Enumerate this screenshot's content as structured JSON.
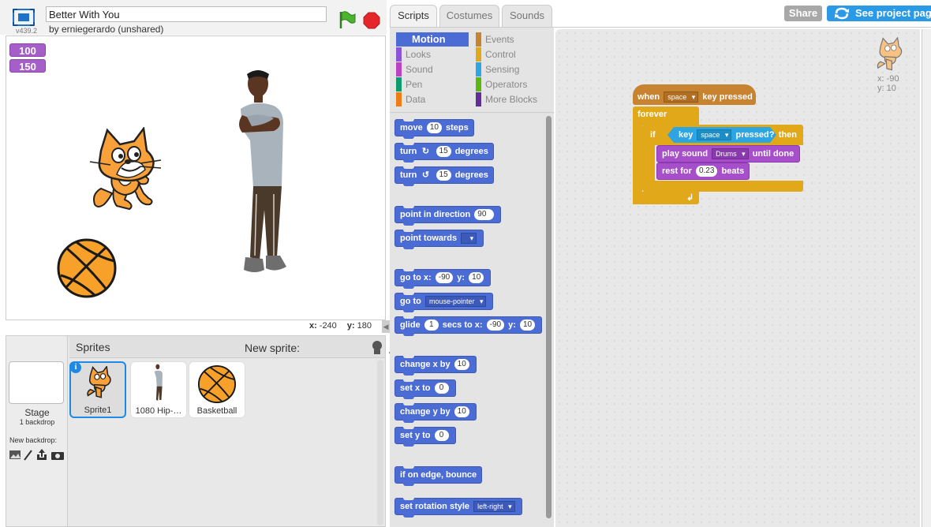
{
  "header": {
    "version": "v439.2",
    "project_title": "Better With You",
    "byline": "by erniegerardo (unshared)"
  },
  "stage": {
    "monitors": [
      "100",
      "150"
    ],
    "coords": {
      "x_label": "x:",
      "x_value": "-240",
      "y_label": "y:",
      "y_value": "180"
    }
  },
  "sprites_panel": {
    "title": "Sprites",
    "new_sprite_label": "New sprite:",
    "stage_label": "Stage",
    "stage_backdrops": "1 backdrop",
    "new_backdrop_label": "New backdrop:",
    "sprites": [
      {
        "name": "Sprite1",
        "selected": true
      },
      {
        "name": "1080 Hip-…",
        "selected": false
      },
      {
        "name": "Basketball",
        "selected": false
      }
    ]
  },
  "tabs": [
    "Scripts",
    "Costumes",
    "Sounds"
  ],
  "top_buttons": {
    "share": "Share",
    "see_project_page": "See project page"
  },
  "categories": {
    "left": [
      "Motion",
      "Looks",
      "Sound",
      "Pen",
      "Data"
    ],
    "right": [
      "Events",
      "Control",
      "Sensing",
      "Operators",
      "More Blocks"
    ],
    "colors": {
      "Motion": "#4a6cd4",
      "Looks": "#8a55d7",
      "Sound": "#bb42c3",
      "Pen": "#0e9a6c",
      "Data": "#ee7d16",
      "Events": "#c88330",
      "Control": "#e1a91a",
      "Sensing": "#2ca5e2",
      "Operators": "#5cb712",
      "More Blocks": "#632d99"
    }
  },
  "palette_blocks": {
    "move": {
      "a": "move",
      "n": "10",
      "b": "steps"
    },
    "turn_cw": {
      "a": "turn",
      "n": "15",
      "b": "degrees"
    },
    "turn_ccw": {
      "a": "turn",
      "n": "15",
      "b": "degrees"
    },
    "point_dir": {
      "a": "point in direction",
      "n": "90"
    },
    "point_towards": {
      "a": "point towards"
    },
    "goto_xy": {
      "a": "go to x:",
      "x": "-90",
      "b": "y:",
      "y": "10"
    },
    "goto": {
      "a": "go to",
      "d": "mouse-pointer"
    },
    "glide": {
      "a": "glide",
      "n": "1",
      "b": "secs to x:",
      "x": "-90",
      "c": "y:",
      "y": "10"
    },
    "change_x": {
      "a": "change x by",
      "n": "10"
    },
    "set_x": {
      "a": "set x to",
      "n": "0"
    },
    "change_y": {
      "a": "change y by",
      "n": "10"
    },
    "set_y": {
      "a": "set y to",
      "n": "0"
    },
    "bounce": {
      "a": "if on edge, bounce"
    },
    "rotation_style": {
      "a": "set rotation style",
      "d": "left-right"
    }
  },
  "script": {
    "hat": {
      "a": "when",
      "key": "space",
      "b": "key pressed"
    },
    "forever": "forever",
    "if": "if",
    "then": "then",
    "sensing": {
      "a": "key",
      "key": "space",
      "b": "pressed?"
    },
    "play_sound": {
      "a": "play sound",
      "sound": "Drums",
      "b": "until done"
    },
    "rest": {
      "a": "rest for",
      "n": "0.23",
      "b": "beats"
    }
  },
  "sprite_info": {
    "x": "x: -90",
    "y": "y: 10"
  }
}
